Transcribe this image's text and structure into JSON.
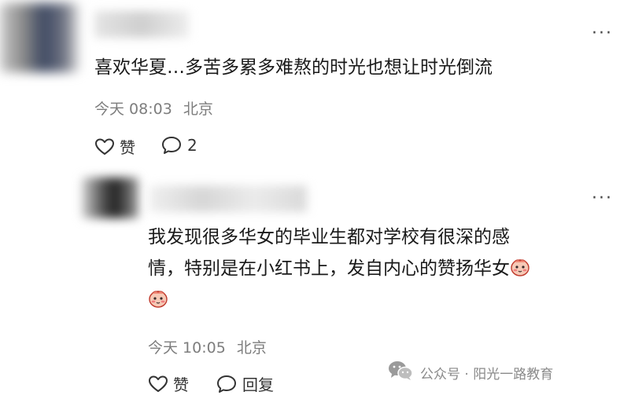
{
  "comment": {
    "text": "喜欢华夏…多苦多累多难熬的时光也想让时光倒流",
    "time": "今天 08:03",
    "location": "北京",
    "like_label": "赞",
    "reply_count": "2"
  },
  "reply": {
    "text_line1": "我发现很多华女的毕业生都对学校有很深的感",
    "text_line2": "情，特别是在小红书上，发自内心的赞扬华女",
    "time": "今天 10:05",
    "location": "北京",
    "like_label": "赞",
    "reply_label": "回复"
  },
  "more_label": "···",
  "watermark": {
    "text": "公众号 · 阳光一路教育"
  },
  "icons": {
    "more": "more-dots-icon",
    "like": "heart-icon",
    "comment": "comment-bubble-icon",
    "emoji": "blushing-face-emoji",
    "wechat": "wechat-logo-icon"
  }
}
